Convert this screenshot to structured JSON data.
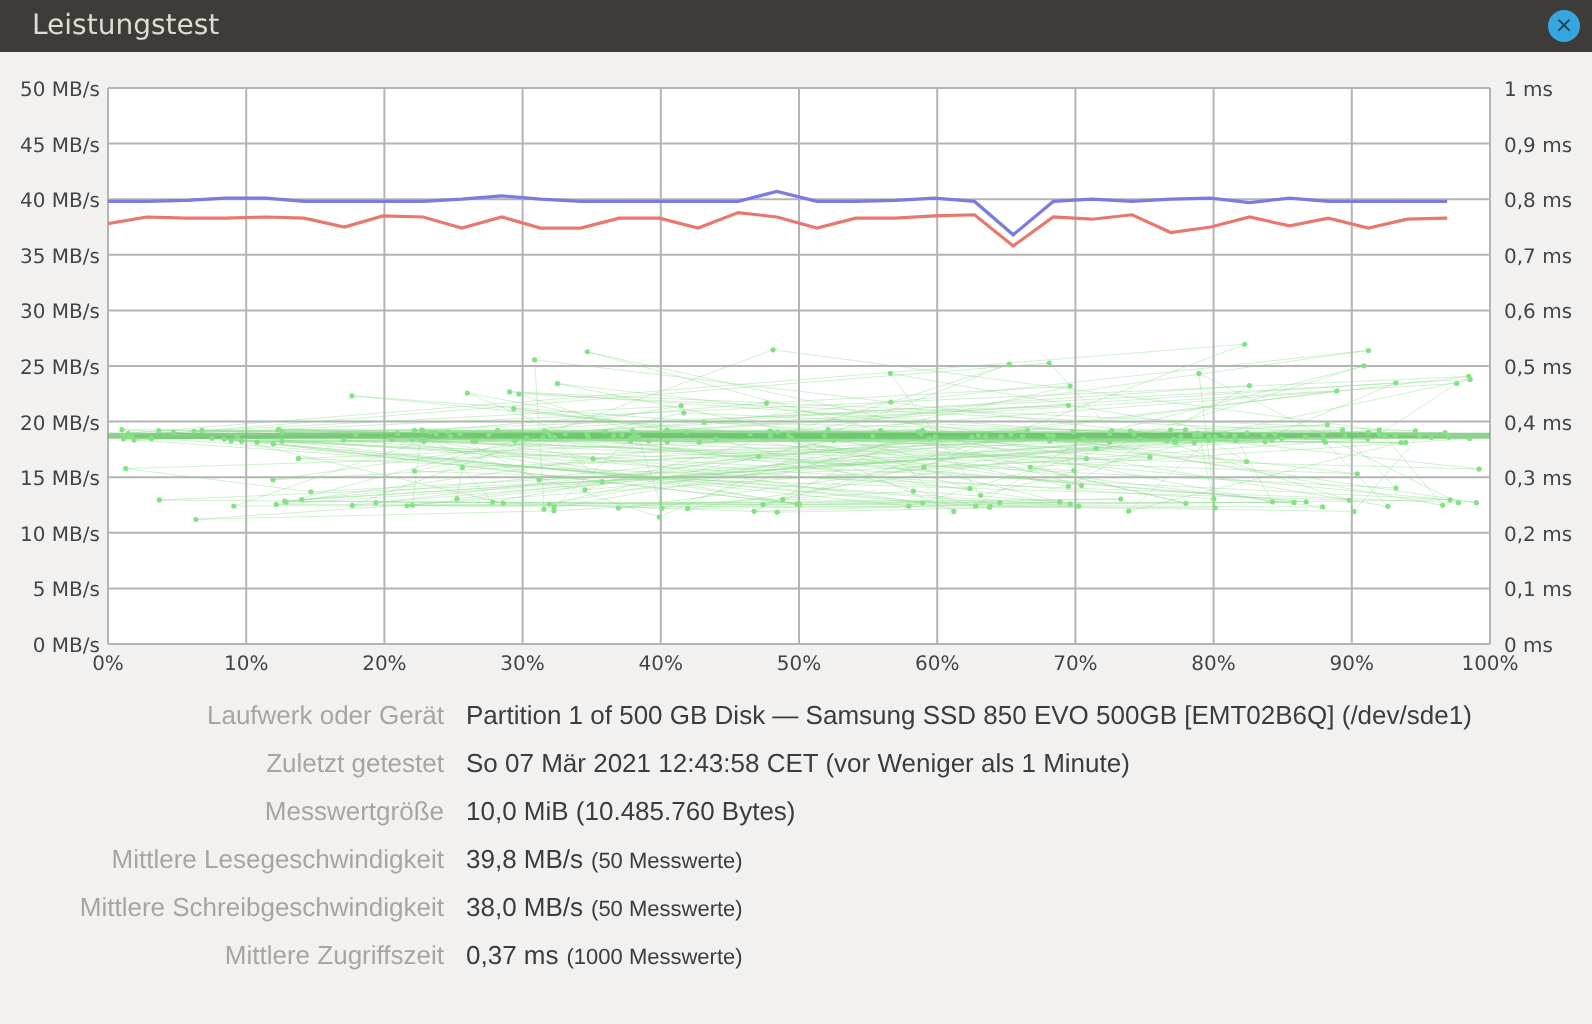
{
  "window": {
    "title": "Leistungstest",
    "close_label": "×"
  },
  "chart": {
    "chart_data": {
      "type": "line",
      "xlim": [
        0,
        100
      ],
      "ylim": [
        0,
        50
      ],
      "y2lim": [
        0,
        1
      ],
      "grid": true,
      "x": [
        0,
        2.8,
        5.7,
        8.5,
        11.4,
        14.2,
        17.1,
        19.9,
        22.8,
        25.6,
        28.5,
        31.3,
        34.2,
        37,
        39.9,
        42.7,
        45.6,
        48.4,
        51.3,
        54.1,
        57,
        59.8,
        62.7,
        65.5,
        68.4,
        71.2,
        74.1,
        76.9,
        79.8,
        82.6,
        85.5,
        88.3,
        91.2,
        94,
        96.9
      ],
      "series": [
        {
          "color": "#7b7be0",
          "values": [
            39.8,
            39.8,
            39.9,
            40.1,
            40.1,
            39.8,
            39.8,
            39.8,
            39.8,
            40.0,
            40.3,
            40.0,
            39.8,
            39.8,
            39.8,
            39.8,
            39.8,
            40.7,
            39.8,
            39.8,
            39.9,
            40.1,
            39.8,
            36.8,
            39.8,
            40.0,
            39.8,
            40.0,
            40.1,
            39.7,
            40.1,
            39.8,
            39.8,
            39.8,
            39.8
          ]
        },
        {
          "color": "#e8786e",
          "values": [
            37.8,
            38.4,
            38.3,
            38.3,
            38.4,
            38.3,
            37.5,
            38.5,
            38.4,
            37.4,
            38.4,
            37.4,
            37.4,
            38.3,
            38.3,
            37.4,
            38.8,
            38.4,
            37.4,
            38.3,
            38.3,
            38.5,
            38.6,
            35.8,
            38.4,
            38.2,
            38.6,
            37.0,
            37.5,
            38.4,
            37.6,
            38.3,
            37.4,
            38.2,
            38.3
          ]
        }
      ],
      "yticks": [
        {
          "value": 0,
          "label": "0 MB/s"
        },
        {
          "value": 5,
          "label": "5 MB/s"
        },
        {
          "value": 10,
          "label": "10 MB/s"
        },
        {
          "value": 15,
          "label": "15 MB/s"
        },
        {
          "value": 20,
          "label": "20 MB/s"
        },
        {
          "value": 25,
          "label": "25 MB/s"
        },
        {
          "value": 30,
          "label": "30 MB/s"
        },
        {
          "value": 35,
          "label": "35 MB/s"
        },
        {
          "value": 40,
          "label": "40 MB/s"
        },
        {
          "value": 45,
          "label": "45 MB/s"
        },
        {
          "value": 50,
          "label": "50 MB/s"
        }
      ],
      "y2ticks": [
        {
          "value": 0,
          "label": "0 ms"
        },
        {
          "value": 0.1,
          "label": "0,1 ms"
        },
        {
          "value": 0.2,
          "label": "0,2 ms"
        },
        {
          "value": 0.3,
          "label": "0,3 ms"
        },
        {
          "value": 0.4,
          "label": "0,4 ms"
        },
        {
          "value": 0.5,
          "label": "0,5 ms"
        },
        {
          "value": 0.6,
          "label": "0,6 ms"
        },
        {
          "value": 0.7,
          "label": "0,7 ms"
        },
        {
          "value": 0.8,
          "label": "0,8 ms"
        },
        {
          "value": 0.9,
          "label": "0,9 ms"
        },
        {
          "value": 1,
          "label": "1 ms"
        }
      ],
      "xticks": [
        {
          "value": 0,
          "label": "0%"
        },
        {
          "value": 10,
          "label": "10%"
        },
        {
          "value": 20,
          "label": "20%"
        },
        {
          "value": 30,
          "label": "30%"
        },
        {
          "value": 40,
          "label": "40%"
        },
        {
          "value": 50,
          "label": "50%"
        },
        {
          "value": 60,
          "label": "60%"
        },
        {
          "value": 70,
          "label": "70%"
        },
        {
          "value": 80,
          "label": "80%"
        },
        {
          "value": 90,
          "label": "90%"
        },
        {
          "value": 100,
          "label": "100%"
        }
      ]
    }
  },
  "details": [
    {
      "label": "Laufwerk oder Gerät",
      "value": "Partition 1 of 500 GB Disk — Samsung SSD 850 EVO 500GB [EMT02B6Q] (/dev/sde1)"
    },
    {
      "label": "Zuletzt getestet",
      "value": "So 07 Mär 2021 12:43:58 CET (vor Weniger als 1 Minute)"
    },
    {
      "label": "Messwertgröße",
      "value": "10,0 MiB (10.485.760 Bytes)"
    },
    {
      "label": "Mittlere Lesegeschwindigkeit",
      "value": "39,8 MB/s",
      "note": "(50 Messwerte)"
    },
    {
      "label": "Mittlere Schreibgeschwindigkeit",
      "value": "38,0 MB/s",
      "note": "(50 Messwerte)"
    },
    {
      "label": "Mittlere Zugriffszeit",
      "value": "0,37 ms",
      "note": "(1000 Messwerte)"
    }
  ]
}
